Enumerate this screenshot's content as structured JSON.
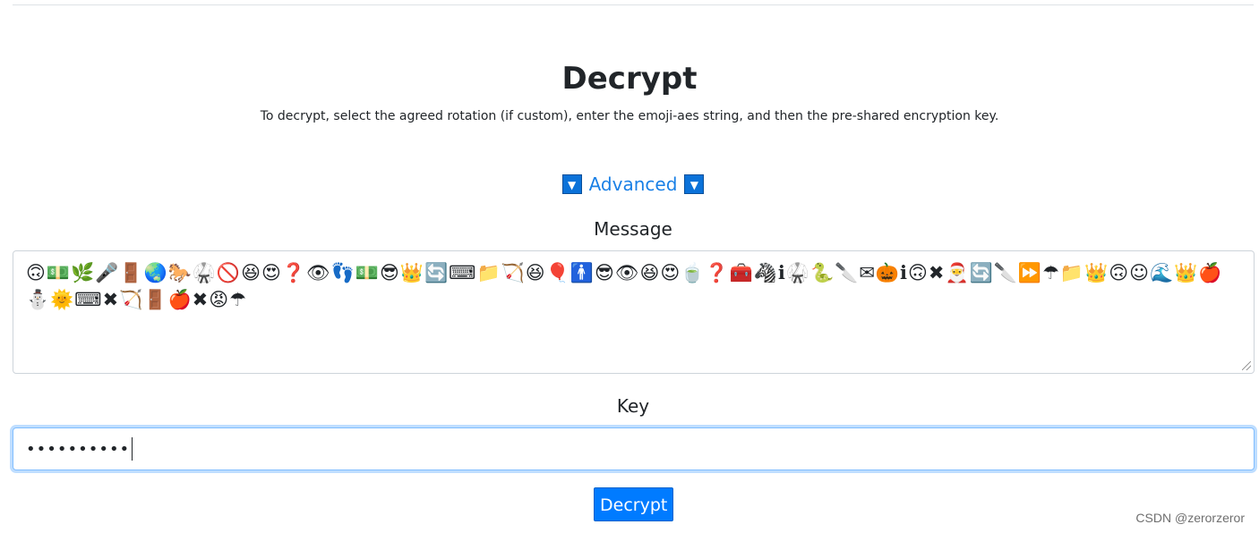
{
  "page": {
    "title": "Decrypt",
    "subtitle": "To decrypt, select the agreed rotation (if custom), enter the emoji-aes string, and then the pre-shared encryption key.",
    "advanced": {
      "label": "Advanced",
      "toggle_left_icon": "▼",
      "toggle_right_icon": "▼"
    },
    "message": {
      "label": "Message",
      "value": "🙃💵🌿🎤🚪🌏🐎🥋🚫😆😍❓👁👣💵😎👑🔄⌨📁🏹😆🎈🚹😎👁😆😍🍵❓🧰🦓ℹ🥋🐍🔪✉🎃ℹ🙃✖🎅🔄🔪⏩☂📁👑🙃☺🌊👑🍎⛄🌞⌨✖🏹🚪🍎✖😡☂"
    },
    "key": {
      "label": "Key",
      "masked_value": "••••••••••"
    },
    "submit_label": "Decrypt",
    "watermark": "CSDN @zerorzeror"
  },
  "colors": {
    "primary": "#007bff",
    "link": "#1a80e6",
    "toggle_box": "#0b72d9",
    "focus_border": "#80bdff",
    "text": "#212529"
  }
}
